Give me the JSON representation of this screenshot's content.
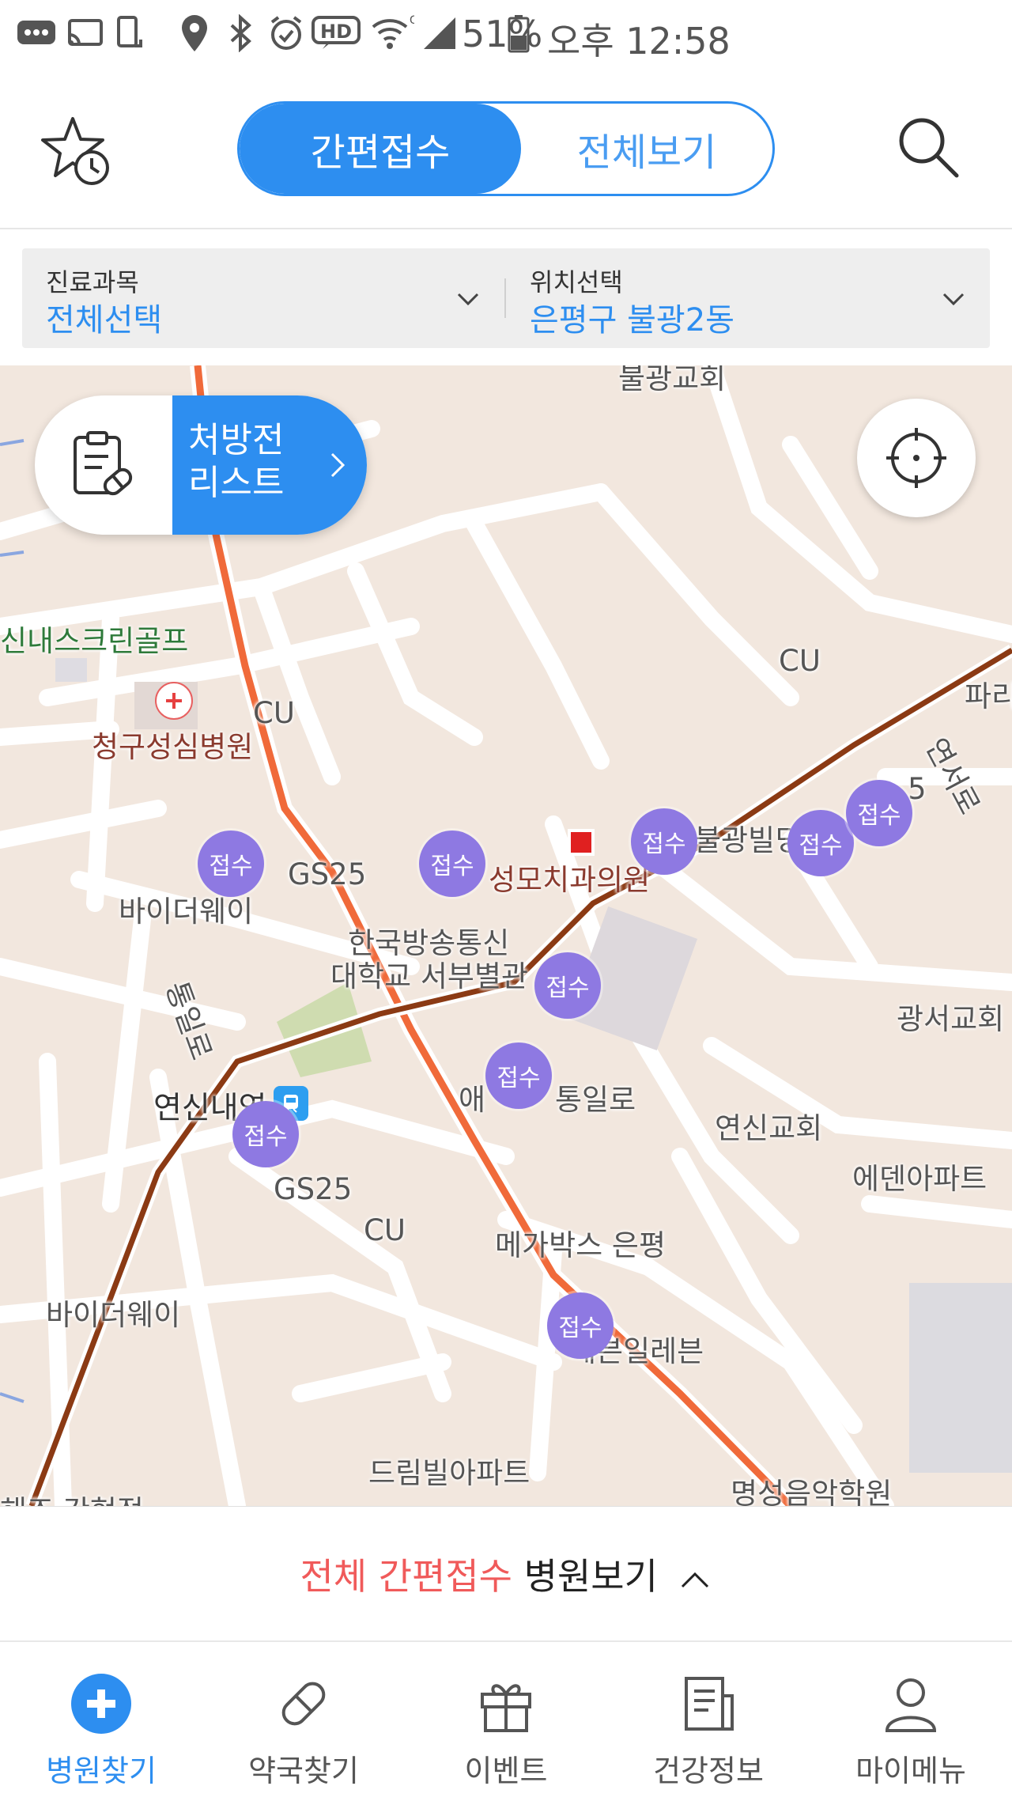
{
  "status_bar": {
    "battery": "51%",
    "time": "오후 12:58",
    "icons": [
      "chat-icon",
      "cast-icon",
      "screen-rotate-icon",
      "location-icon",
      "bluetooth-icon",
      "alarm-icon",
      "hd-icon",
      "wifi-icon",
      "signal-icon",
      "battery-icon"
    ]
  },
  "header": {
    "tabs": [
      {
        "label": "간편접수",
        "active": true
      },
      {
        "label": "전체보기",
        "active": false
      }
    ]
  },
  "filters": {
    "subject": {
      "label": "진료과목",
      "value": "전체선택"
    },
    "location": {
      "label": "위치선택",
      "value": "은평구 불광2동"
    }
  },
  "map": {
    "prescription_button": "처방전\n리스트",
    "pins": [
      "접수",
      "접수",
      "접수",
      "접수",
      "접수",
      "접수",
      "접수",
      "접수",
      "접수"
    ],
    "labels": {
      "top_cut": "불광교회",
      "golf": "신내스크린골프",
      "hospital": "청구성심병원",
      "cu1": "CU",
      "cu2": "CU",
      "cu3": "CU",
      "paris": "파리",
      "gs25_1": "GS25",
      "gs25_2": "GS25",
      "gs25_3": "5",
      "bulgwang_bldg": "불광빌딩",
      "dental": "성모치과의원",
      "byther1": "바이더웨이",
      "byther2": "바이더웨이",
      "univ1": "한국방송통신",
      "univ2": "대학교 서부별관",
      "tongil1": "통일로",
      "tongil2": "통일로",
      "yeonseo": "연서로",
      "gwangseo": "광서교회",
      "station": "연신내역",
      "yeonsin_church": "연신교회",
      "eden": "에덴아파트",
      "megabox": "메가박스 은평",
      "seven": "세븐일레븐",
      "dreamville": "드림빌아파트",
      "myungsung": "명성음악학원",
      "bottom_cut": "해조 간현적",
      "ae": "애"
    }
  },
  "sheet": {
    "red_text": "전체 간편접수",
    "dark_text": "병원보기"
  },
  "nav": {
    "items": [
      {
        "label": "병원찾기",
        "icon": "hospital-cross-icon",
        "active": true
      },
      {
        "label": "약국찾기",
        "icon": "pill-icon",
        "active": false
      },
      {
        "label": "이벤트",
        "icon": "gift-icon",
        "active": false
      },
      {
        "label": "건강정보",
        "icon": "document-icon",
        "active": false
      },
      {
        "label": "마이메뉴",
        "icon": "person-icon",
        "active": false
      }
    ]
  },
  "colors": {
    "accent": "#2d8ef0",
    "pin": "#8e79e2",
    "sheet_red": "#f05a5a",
    "map_bg": "#f2e7de",
    "subway_line": "#8b3a14",
    "main_road": "#f06a3a"
  }
}
